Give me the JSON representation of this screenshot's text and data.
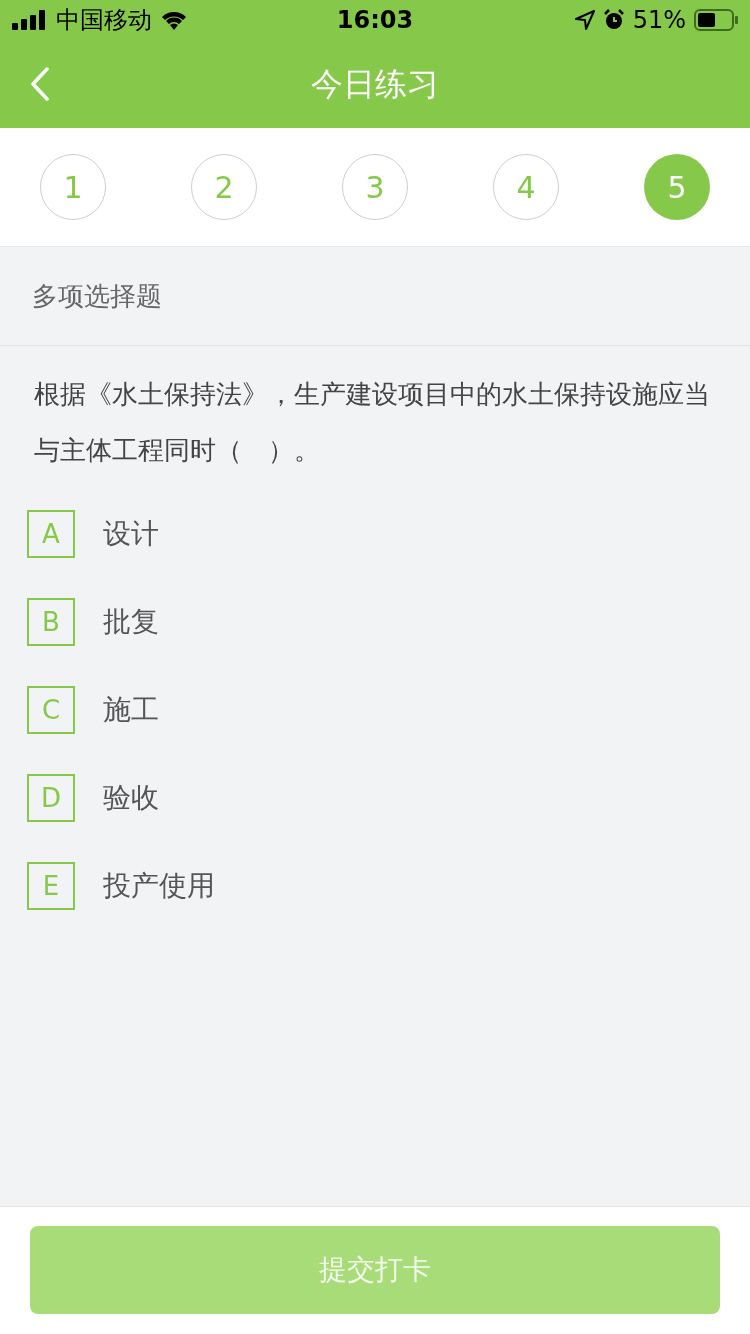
{
  "status_bar": {
    "carrier": "中国移动",
    "time": "16:03",
    "battery": "51%"
  },
  "nav": {
    "title": "今日练习"
  },
  "steps": [
    {
      "label": "1",
      "selected": false
    },
    {
      "label": "2",
      "selected": false
    },
    {
      "label": "3",
      "selected": false
    },
    {
      "label": "4",
      "selected": false
    },
    {
      "label": "5",
      "selected": true
    }
  ],
  "question_type": "多项选择题",
  "question": "根据《水土保持法》，生产建设项目中的水土保持设施应当与主体工程同时（　）。",
  "options": [
    {
      "letter": "A",
      "text": "设计",
      "selected": false
    },
    {
      "letter": "B",
      "text": "批复",
      "selected": false
    },
    {
      "letter": "C",
      "text": "施工",
      "selected": false
    },
    {
      "letter": "D",
      "text": "验收",
      "selected": false
    },
    {
      "letter": "E",
      "text": "投产使用",
      "selected": false
    }
  ],
  "submit": {
    "label": "提交打卡",
    "disabled": true
  }
}
